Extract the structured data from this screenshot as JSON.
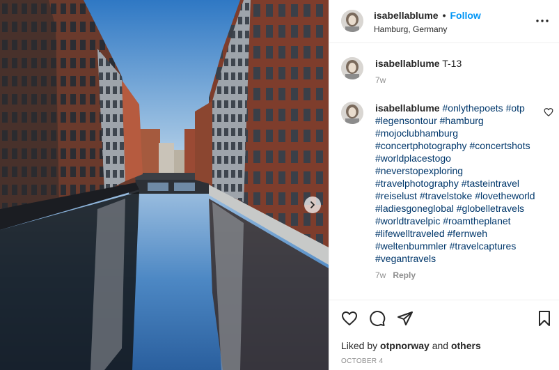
{
  "colors": {
    "link_blue": "#0095f6",
    "hashtag_blue": "#00376b",
    "muted": "#8e8e8e",
    "text": "#262626"
  },
  "header": {
    "username": "isabellablume",
    "separator": "•",
    "follow_label": "Follow",
    "location": "Hamburg, Germany",
    "more_icon": "more-horizontal-icon"
  },
  "comments": [
    {
      "username": "isabellablume",
      "text": "T-13",
      "time": "7w"
    },
    {
      "username": "isabellablume",
      "hashtags": [
        "#onlythepoets",
        "#otp",
        "#legensontour",
        "#hamburg",
        "#mojoclubhamburg",
        "#concertphotography",
        "#concertshots",
        "#worldplacestogo",
        "#neverstopexploring",
        "#travelphotography",
        "#tasteintravel",
        "#reiselust",
        "#travelstoke",
        "#lovetheworld",
        "#ladiesgoneglobal",
        "#globelletravels",
        "#worldtravelpic",
        "#roamtheplanet",
        "#lifewelltraveled",
        "#fernweh",
        "#weltenbummler",
        "#travelcaptures",
        "#vegantravels"
      ],
      "time": "7w",
      "reply_label": "Reply"
    }
  ],
  "actions": {
    "icons": [
      "heart-icon",
      "comment-icon",
      "share-icon",
      "bookmark-icon"
    ],
    "liked_by_prefix": "Liked by",
    "liked_by_user": "otpnorway",
    "liked_by_and": "and",
    "liked_by_others": "others",
    "date": "OCTOBER 4"
  },
  "photo": {
    "next_icon": "chevron-right-icon"
  }
}
